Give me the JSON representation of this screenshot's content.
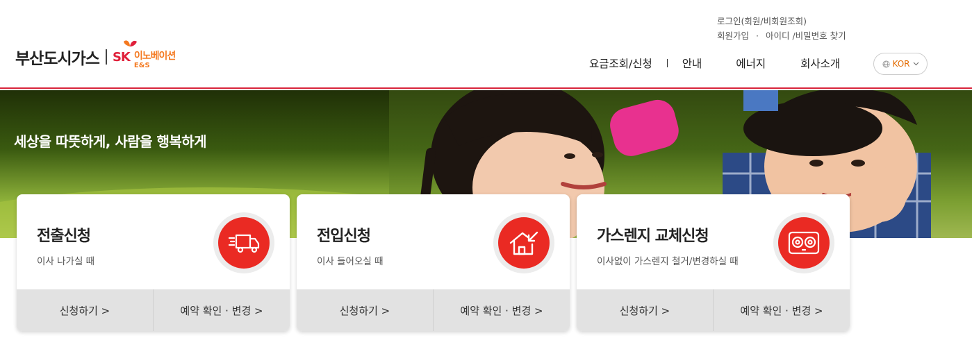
{
  "brand": {
    "name": "부산도시가스",
    "partner_mark": "SK",
    "partner_name": "이노베이션",
    "partner_sub": "E&S"
  },
  "utility": {
    "login": "로그인(회원/비회원조회)",
    "join": "회원가입",
    "dot": "·",
    "find": "아이디 /비밀번호 찾기"
  },
  "nav": {
    "items": [
      "요금조회/신청",
      "안내",
      "에너지",
      "회사소개"
    ],
    "language": "KOR"
  },
  "hero": {
    "slogan": "세상을 따뜻하게, 사람을 행복하게"
  },
  "cards": [
    {
      "title": "전출신청",
      "desc": "이사 나가실 때",
      "icon": "moving-truck-icon",
      "apply": "신청하기 >",
      "check": "예약 확인 · 변경 >"
    },
    {
      "title": "전입신청",
      "desc": "이사 들어오실 때",
      "icon": "house-move-in-icon",
      "apply": "신청하기 >",
      "check": "예약 확인 · 변경 >"
    },
    {
      "title": "가스렌지 교체신청",
      "desc": "이사없이 가스렌지 철거/변경하실 때",
      "icon": "gas-range-icon",
      "apply": "신청하기 >",
      "check": "예약 확인 · 변경 >"
    }
  ],
  "colors": {
    "accent_red": "#ea2a23",
    "header_line": "#d7243a",
    "sk_orange": "#f47920"
  }
}
